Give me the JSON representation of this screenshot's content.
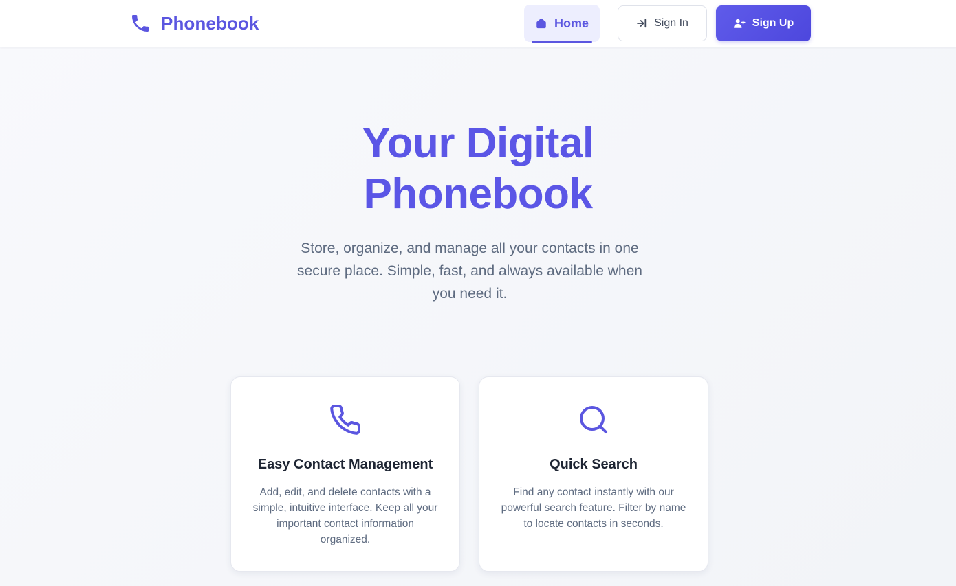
{
  "nav": {
    "brand": "Phonebook",
    "brand_icon": "phone-icon",
    "home_label": "Home",
    "home_icon": "home-icon",
    "signin_label": "Sign In",
    "signin_icon": "sign-in-icon",
    "signup_label": "Sign Up",
    "signup_icon": "user-plus-icon"
  },
  "hero": {
    "title_line1": "Your Digital",
    "title_line2": "Phonebook",
    "subtitle": "Store, organize, and manage all your contacts in one secure place. Simple, fast, and always available when you need it."
  },
  "features": [
    {
      "icon": "phone-icon",
      "title": "Easy Contact Management",
      "description": "Add, edit, and delete contacts with a simple, intuitive interface. Keep all your important contact information organized."
    },
    {
      "icon": "search-icon",
      "title": "Quick Search",
      "description": "Find any contact instantly with our powerful search feature. Filter by name to locate contacts in seconds."
    }
  ],
  "colors": {
    "accent": "#5b56e0",
    "text_dark": "#1e2533",
    "text_muted": "#5e6b80",
    "background": "#f4f6fa"
  }
}
